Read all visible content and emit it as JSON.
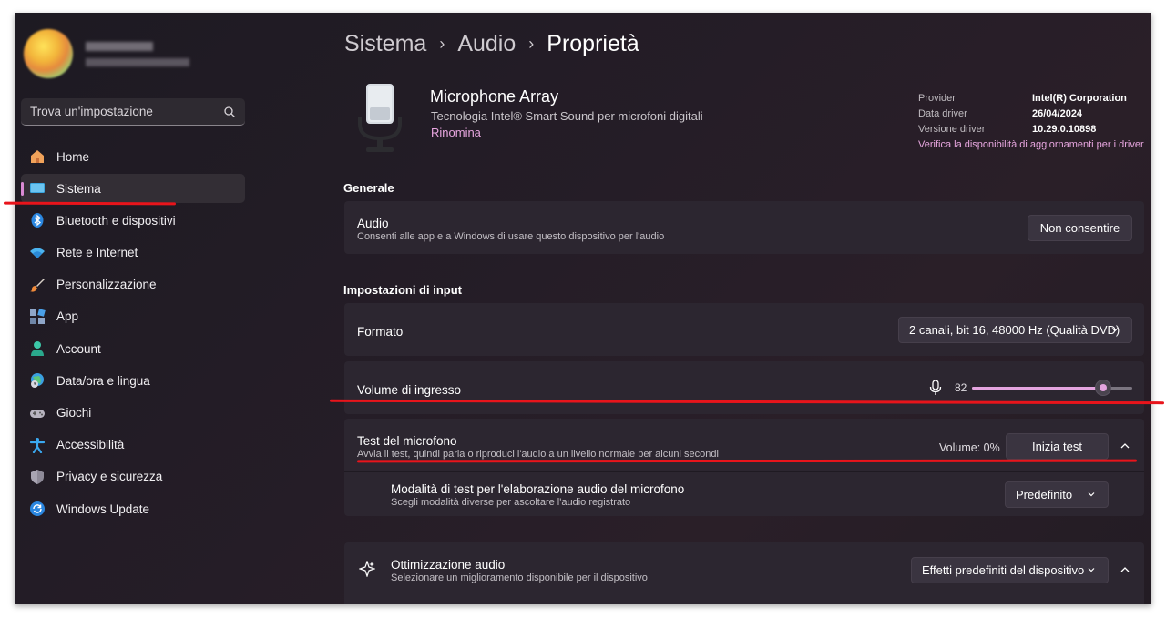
{
  "sidebar": {
    "search_placeholder": "Trova un'impostazione",
    "items": [
      {
        "label": "Home",
        "icon": "home-icon"
      },
      {
        "label": "Sistema",
        "icon": "system-icon"
      },
      {
        "label": "Bluetooth e dispositivi",
        "icon": "bluetooth-icon"
      },
      {
        "label": "Rete e Internet",
        "icon": "wifi-icon"
      },
      {
        "label": "Personalizzazione",
        "icon": "brush-icon"
      },
      {
        "label": "App",
        "icon": "apps-icon"
      },
      {
        "label": "Account",
        "icon": "account-icon"
      },
      {
        "label": "Data/ora e lingua",
        "icon": "globe-clock-icon"
      },
      {
        "label": "Giochi",
        "icon": "gamepad-icon"
      },
      {
        "label": "Accessibilità",
        "icon": "accessibility-icon"
      },
      {
        "label": "Privacy e sicurezza",
        "icon": "shield-icon"
      },
      {
        "label": "Windows Update",
        "icon": "update-icon"
      }
    ],
    "active_index": 1
  },
  "breadcrumb": {
    "part1": "Sistema",
    "part2": "Audio",
    "current": "Proprietà",
    "separator": "›"
  },
  "device": {
    "name": "Microphone Array",
    "description": "Tecnologia Intel® Smart Sound per microfoni digitali",
    "rename_link": "Rinomina",
    "driver": {
      "provider_label": "Provider",
      "provider_value": "Intel(R) Corporation",
      "date_label": "Data driver",
      "date_value": "26/04/2024",
      "version_label": "Versione driver",
      "version_value": "10.29.0.10898",
      "update_link": "Verifica la disponibilità di aggiornamenti per i driver"
    }
  },
  "generale": {
    "section_title": "Generale",
    "audio_title": "Audio",
    "audio_desc": "Consenti alle app e a Windows di usare questo dispositivo per l'audio",
    "audio_button": "Non consentire"
  },
  "input": {
    "section_title": "Impostazioni di input",
    "format_label": "Formato",
    "format_value": "2 canali, bit 16, 48000 Hz (Qualità DVD)",
    "volume_label": "Volume di ingresso",
    "volume_value": "82",
    "volume_level": 82,
    "test_title": "Test del microfono",
    "test_desc": "Avvia il test, quindi parla o riproduci l'audio a un livello normale per alcuni secondi",
    "test_volume": "Volume: 0%",
    "test_button": "Inizia test",
    "mode_title": "Modalità di test per l'elaborazione audio del microfono",
    "mode_desc": "Scegli modalità diverse per ascoltare l'audio registrato",
    "mode_value": "Predefinito",
    "opt_title": "Ottimizzazione audio",
    "opt_desc": "Selezionare un miglioramento disponibile per il dispositivo",
    "opt_value": "Effetti predefiniti del dispositivo"
  },
  "colors": {
    "accent": "#d98ad3",
    "annotation": "#e8141b"
  }
}
